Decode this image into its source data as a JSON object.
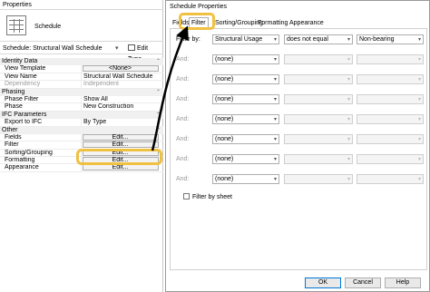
{
  "properties": {
    "title": "Properties",
    "type_name": "Schedule",
    "selector": "Schedule: Structural Wall Schedule",
    "edit_type": "Edit Type",
    "groups": [
      {
        "name": "Identity Data",
        "rows": [
          {
            "key": "View Template",
            "value": "<None>",
            "kind": "button"
          },
          {
            "key": "View Name",
            "value": "Structural Wall Schedule",
            "kind": "text"
          },
          {
            "key": "Dependency",
            "value": "Independent",
            "kind": "muted"
          }
        ]
      },
      {
        "name": "Phasing",
        "rows": [
          {
            "key": "Phase Filter",
            "value": "Show All",
            "kind": "text"
          },
          {
            "key": "Phase",
            "value": "New Construction",
            "kind": "text"
          }
        ]
      },
      {
        "name": "IFC Parameters",
        "rows": [
          {
            "key": "Export to IFC",
            "value": "By Type",
            "kind": "text"
          }
        ]
      },
      {
        "name": "Other",
        "rows": [
          {
            "key": "Fields",
            "value": "Edit...",
            "kind": "button"
          },
          {
            "key": "Filter",
            "value": "Edit...",
            "kind": "button"
          },
          {
            "key": "Sorting/Grouping",
            "value": "Edit...",
            "kind": "button"
          },
          {
            "key": "Formatting",
            "value": "Edit...",
            "kind": "button"
          },
          {
            "key": "Appearance",
            "value": "Edit...",
            "kind": "button"
          }
        ]
      }
    ]
  },
  "dialog": {
    "title": "Schedule Properties",
    "tabs": [
      "Fields",
      "Filter",
      "Sorting/Grouping",
      "Formatting",
      "Appearance"
    ],
    "active_tab": "Filter",
    "filter_rows": [
      {
        "label": "Filter by:",
        "field": "Structural Usage",
        "op": "does not equal",
        "value": "Non-bearing",
        "enabled": true
      },
      {
        "label": "And:",
        "field": "(none)",
        "op": "",
        "value": "",
        "enabled": false
      },
      {
        "label": "And:",
        "field": "(none)",
        "op": "",
        "value": "",
        "enabled": false
      },
      {
        "label": "And:",
        "field": "(none)",
        "op": "",
        "value": "",
        "enabled": false
      },
      {
        "label": "And:",
        "field": "(none)",
        "op": "",
        "value": "",
        "enabled": false
      },
      {
        "label": "And:",
        "field": "(none)",
        "op": "",
        "value": "",
        "enabled": false
      },
      {
        "label": "And:",
        "field": "(none)",
        "op": "",
        "value": "",
        "enabled": false
      },
      {
        "label": "And:",
        "field": "(none)",
        "op": "",
        "value": "",
        "enabled": false
      }
    ],
    "filter_by_sheet": "Filter by sheet",
    "buttons": {
      "ok": "OK",
      "cancel": "Cancel",
      "help": "Help"
    }
  },
  "colors": {
    "highlight": "#f0c141",
    "arrow": "#000000"
  }
}
